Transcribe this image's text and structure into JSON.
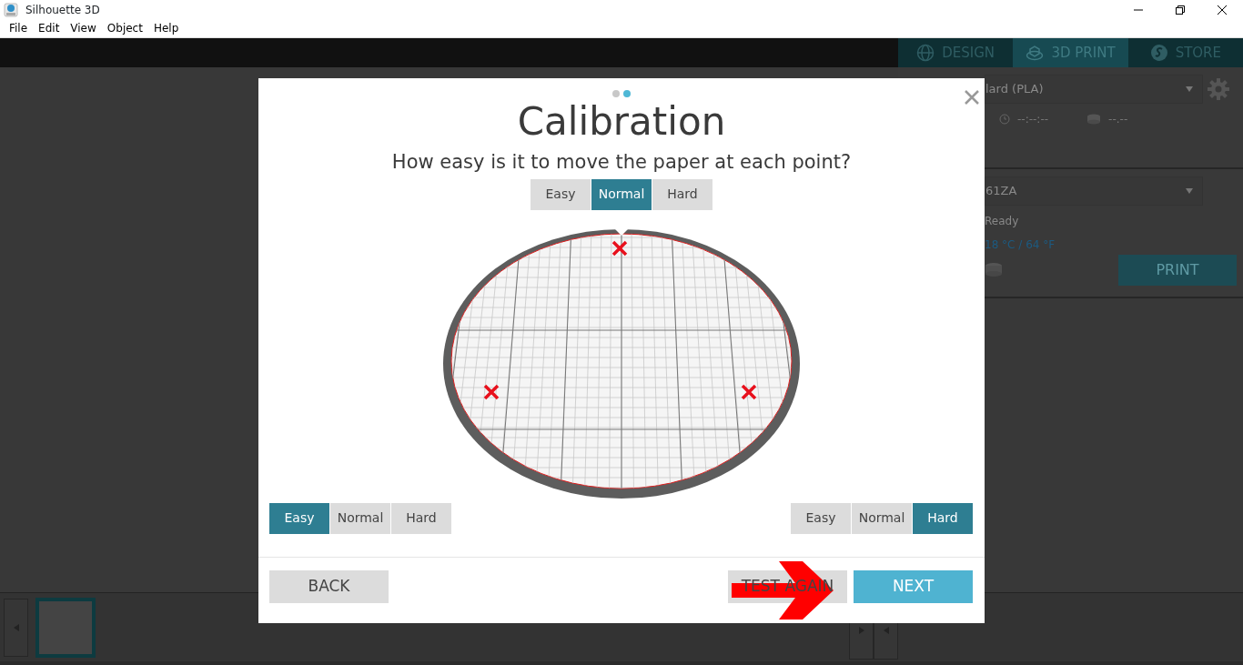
{
  "window": {
    "title": "Silhouette 3D"
  },
  "menu": [
    "File",
    "Edit",
    "View",
    "Object",
    "Help"
  ],
  "mode_tabs": [
    {
      "label": "DESIGN",
      "selected": false
    },
    {
      "label": "3D PRINT",
      "selected": true
    },
    {
      "label": "STORE",
      "selected": false
    }
  ],
  "print_panel": {
    "material": "lard (PLA)",
    "print_time": "--:--:--",
    "filament_amount": "--.--",
    "printer": "61ZA",
    "status": "Ready",
    "temperature": "18 °C / 64 °F",
    "print_button": "PRINT"
  },
  "dialog": {
    "steps": [
      {
        "selected": false
      },
      {
        "selected": true
      }
    ],
    "title": "Calibration",
    "question": "How easy is it to move the paper at each point?",
    "top_point": [
      {
        "label": "Easy",
        "selected": false
      },
      {
        "label": "Normal",
        "selected": true
      },
      {
        "label": "Hard",
        "selected": false
      }
    ],
    "left_point": [
      {
        "label": "Easy",
        "selected": true
      },
      {
        "label": "Normal",
        "selected": false
      },
      {
        "label": "Hard",
        "selected": false
      }
    ],
    "right_point": [
      {
        "label": "Easy",
        "selected": false
      },
      {
        "label": "Normal",
        "selected": false
      },
      {
        "label": "Hard",
        "selected": true
      }
    ],
    "back_button": "BACK",
    "test_again_button": "TEST AGAIN",
    "next_button": "NEXT"
  }
}
